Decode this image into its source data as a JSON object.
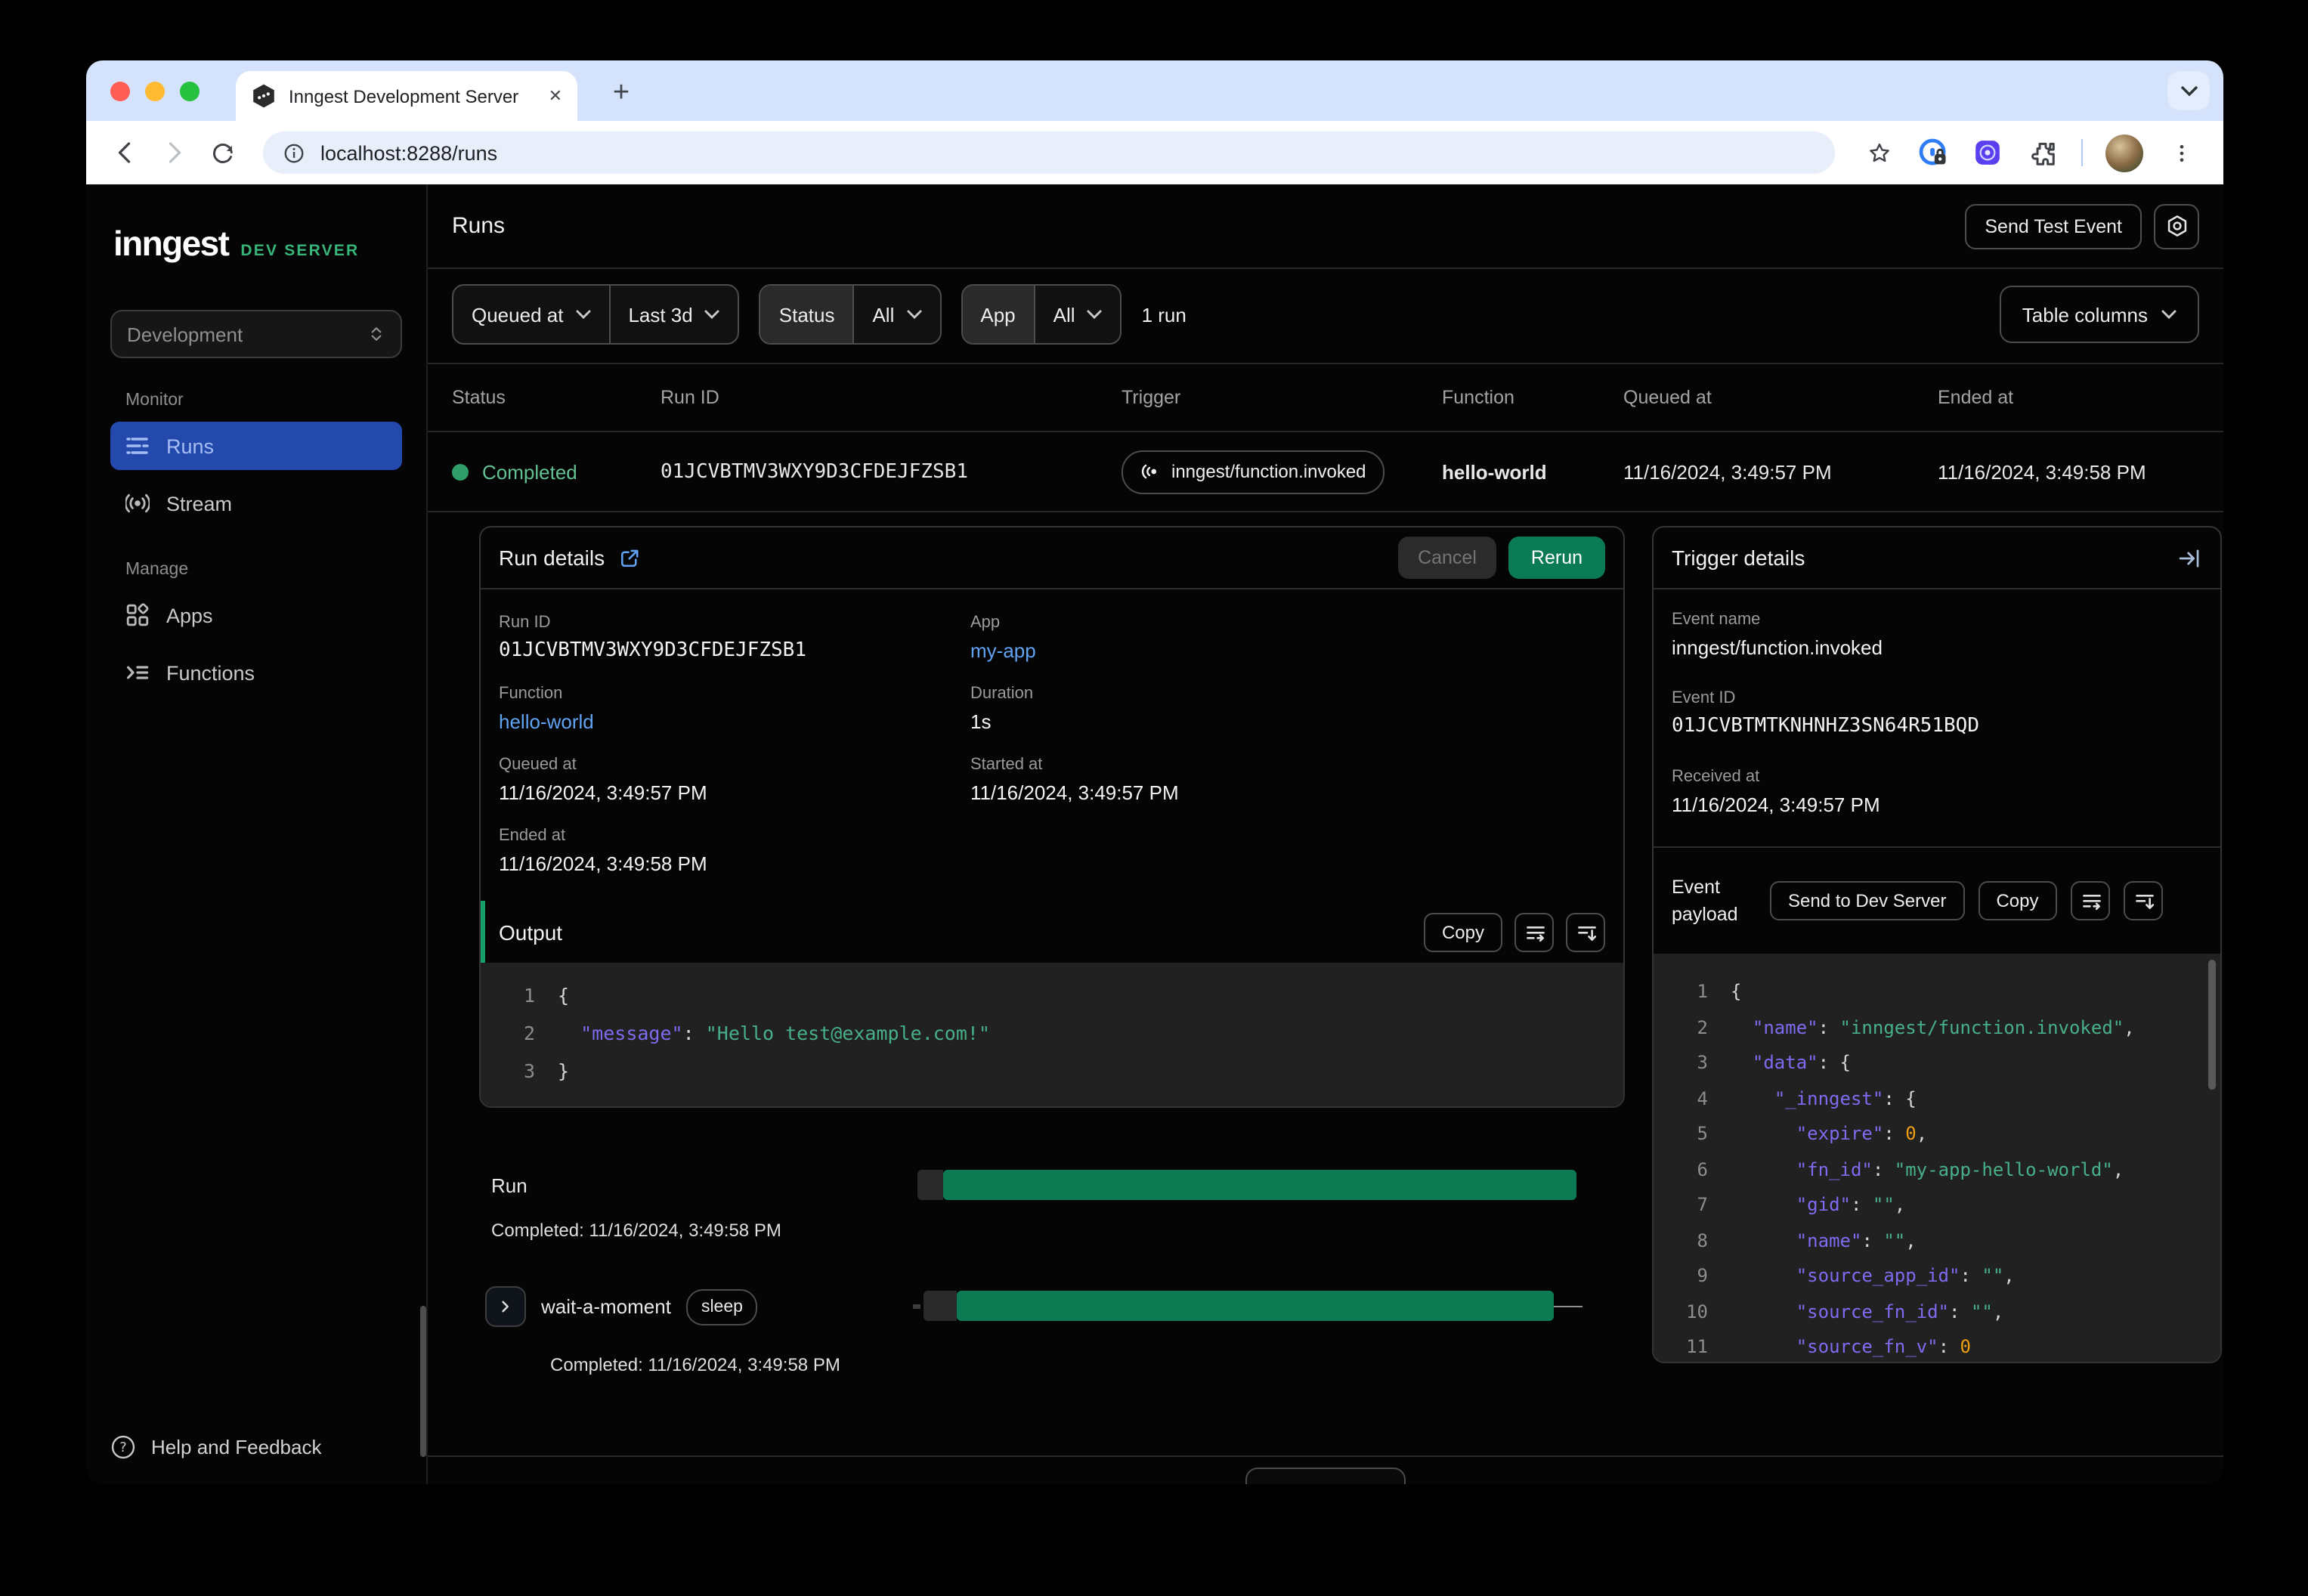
{
  "browser": {
    "tab_title": "Inngest Development Server",
    "url": "localhost:8288/runs"
  },
  "sidebar": {
    "logo": "inngest",
    "badge": "DEV SERVER",
    "environment": "Development",
    "monitor_label": "Monitor",
    "manage_label": "Manage",
    "items": {
      "runs": "Runs",
      "stream": "Stream",
      "apps": "Apps",
      "functions": "Functions"
    },
    "help": "Help and Feedback"
  },
  "header": {
    "title": "Runs",
    "send_test_event": "Send Test Event"
  },
  "filters": {
    "field": "Queued at",
    "range": "Last 3d",
    "status_label": "Status",
    "status_value": "All",
    "app_label": "App",
    "app_value": "All",
    "result_count": "1 run",
    "table_columns": "Table columns"
  },
  "table": {
    "columns": [
      "Status",
      "Run ID",
      "Trigger",
      "Function",
      "Queued at",
      "Ended at"
    ],
    "row": {
      "status": "Completed",
      "run_id": "01JCVBTMV3WXY9D3CFDEJFZSB1",
      "trigger": "inngest/function.invoked",
      "function": "hello-world",
      "queued_at": "11/16/2024, 3:49:57 PM",
      "ended_at": "11/16/2024, 3:49:58 PM"
    }
  },
  "run_details": {
    "title": "Run details",
    "cancel": "Cancel",
    "rerun": "Rerun",
    "run_id_label": "Run ID",
    "run_id": "01JCVBTMV3WXY9D3CFDEJFZSB1",
    "app_label": "App",
    "app": "my-app",
    "function_label": "Function",
    "function": "hello-world",
    "duration_label": "Duration",
    "duration": "1s",
    "queued_label": "Queued at",
    "queued": "11/16/2024, 3:49:57 PM",
    "started_label": "Started at",
    "started": "11/16/2024, 3:49:57 PM",
    "ended_label": "Ended at",
    "ended": "11/16/2024, 3:49:58 PM"
  },
  "output": {
    "title": "Output",
    "copy": "Copy",
    "lines": [
      {
        "n": "1",
        "parts": [
          [
            "{",
            "p"
          ]
        ]
      },
      {
        "n": "2",
        "parts": [
          [
            "  ",
            "p"
          ],
          [
            "\"message\"",
            "k"
          ],
          [
            ": ",
            "p"
          ],
          [
            "\"Hello test@example.com!\"",
            "s"
          ]
        ]
      },
      {
        "n": "3",
        "parts": [
          [
            "}",
            "p"
          ]
        ]
      }
    ]
  },
  "timeline": {
    "run_label": "Run",
    "run_completed": "Completed: 11/16/2024, 3:49:58 PM",
    "step_name": "wait-a-moment",
    "step_type": "sleep",
    "step_completed": "Completed: 11/16/2024, 3:49:58 PM"
  },
  "trigger": {
    "title": "Trigger details",
    "event_name_label": "Event name",
    "event_name": "inngest/function.invoked",
    "event_id_label": "Event ID",
    "event_id": "01JCVBTMTKNHNHZ3SN64R51BQD",
    "received_label": "Received at",
    "received_at": "11/16/2024, 3:49:57 PM",
    "payload_label": "Event payload",
    "send_to_dev_server": "Send to Dev Server",
    "copy": "Copy",
    "lines": [
      {
        "n": "1",
        "parts": [
          [
            "{",
            "p"
          ]
        ]
      },
      {
        "n": "2",
        "parts": [
          [
            "  ",
            "p"
          ],
          [
            "\"name\"",
            "k"
          ],
          [
            ": ",
            "p"
          ],
          [
            "\"inngest/function.invoked\"",
            "s"
          ],
          [
            ",",
            "p"
          ]
        ]
      },
      {
        "n": "3",
        "parts": [
          [
            "  ",
            "p"
          ],
          [
            "\"data\"",
            "k"
          ],
          [
            ": {",
            "p"
          ]
        ]
      },
      {
        "n": "4",
        "parts": [
          [
            "    ",
            "p"
          ],
          [
            "\"_inngest\"",
            "k"
          ],
          [
            ": {",
            "p"
          ]
        ]
      },
      {
        "n": "5",
        "parts": [
          [
            "      ",
            "p"
          ],
          [
            "\"expire\"",
            "k"
          ],
          [
            ": ",
            "p"
          ],
          [
            "0",
            "n"
          ],
          [
            ",",
            "p"
          ]
        ]
      },
      {
        "n": "6",
        "parts": [
          [
            "      ",
            "p"
          ],
          [
            "\"fn_id\"",
            "k"
          ],
          [
            ": ",
            "p"
          ],
          [
            "\"my-app-hello-world\"",
            "s"
          ],
          [
            ",",
            "p"
          ]
        ]
      },
      {
        "n": "7",
        "parts": [
          [
            "      ",
            "p"
          ],
          [
            "\"gid\"",
            "k"
          ],
          [
            ": ",
            "p"
          ],
          [
            "\"\"",
            "s"
          ],
          [
            ",",
            "p"
          ]
        ]
      },
      {
        "n": "8",
        "parts": [
          [
            "      ",
            "p"
          ],
          [
            "\"name\"",
            "k"
          ],
          [
            ": ",
            "p"
          ],
          [
            "\"\"",
            "s"
          ],
          [
            ",",
            "p"
          ]
        ]
      },
      {
        "n": "9",
        "parts": [
          [
            "      ",
            "p"
          ],
          [
            "\"source_app_id\"",
            "k"
          ],
          [
            ": ",
            "p"
          ],
          [
            "\"\"",
            "s"
          ],
          [
            ",",
            "p"
          ]
        ]
      },
      {
        "n": "10",
        "parts": [
          [
            "      ",
            "p"
          ],
          [
            "\"source_fn_id\"",
            "k"
          ],
          [
            ": ",
            "p"
          ],
          [
            "\"\"",
            "s"
          ],
          [
            ",",
            "p"
          ]
        ]
      },
      {
        "n": "11",
        "parts": [
          [
            "      ",
            "p"
          ],
          [
            "\"source_fn_v\"",
            "k"
          ],
          [
            ": ",
            "p"
          ],
          [
            "0",
            "n"
          ]
        ]
      }
    ]
  },
  "colors": {
    "accent_green": "#37b579",
    "active_blue": "#2349ac",
    "link_blue": "#61a3f3",
    "status_green": "#63c194",
    "bar_green": "#0c7a52",
    "rerun_green": "#0b7b55",
    "code_key": "#7d6bf0",
    "code_string": "#48b088",
    "code_number": "#ef9f13"
  }
}
